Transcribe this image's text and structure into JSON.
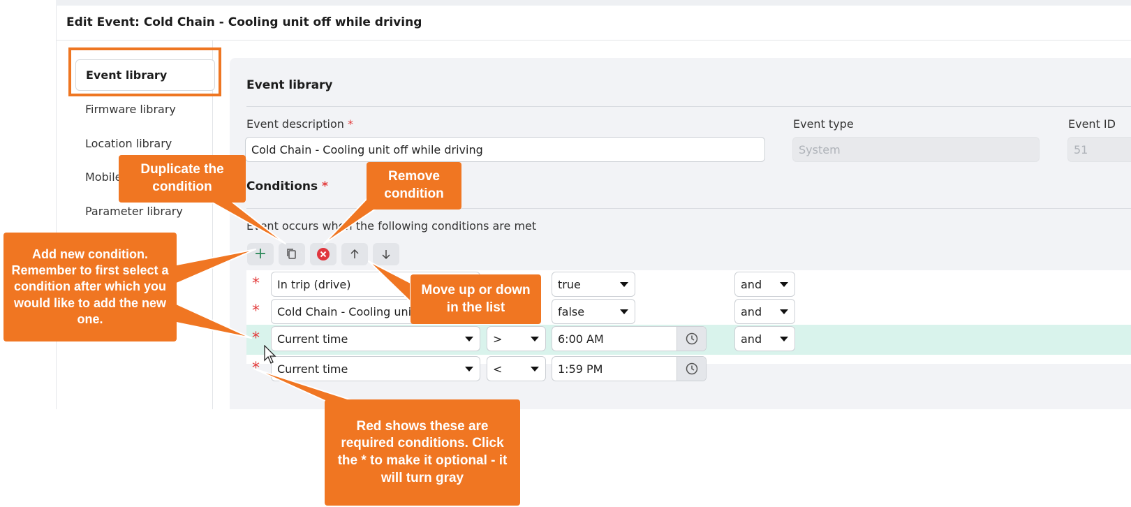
{
  "window_title": "Edit Event: Cold Chain - Cooling unit off while driving",
  "sidebar": {
    "items": [
      {
        "label": "Event library",
        "active": true
      },
      {
        "label": "Firmware library"
      },
      {
        "label": "Location library"
      },
      {
        "label": "Mobile"
      },
      {
        "label": "Parameter library"
      }
    ]
  },
  "section_title": "Event library",
  "fields": {
    "description": {
      "label": "Event description",
      "required": "*",
      "value": "Cold Chain - Cooling unit off while driving"
    },
    "type": {
      "label": "Event type",
      "value": "System"
    },
    "id": {
      "label": "Event ID",
      "value": "51"
    }
  },
  "conditions": {
    "label": "Conditions",
    "required": "*",
    "hint": "Event occurs when the following conditions are met",
    "toolbar": [
      "add",
      "duplicate",
      "remove",
      "move-up",
      "move-down"
    ],
    "rows": [
      {
        "required_mark": "*",
        "param": "In trip (drive)",
        "value": "true",
        "logic": "and"
      },
      {
        "required_mark": "*",
        "param": "Cold Chain - Cooling unit off",
        "value": "false",
        "logic": "and"
      },
      {
        "required_mark": "*",
        "param": "Current time",
        "operator": ">",
        "value": "6:00 AM",
        "logic": "and",
        "selected": true
      },
      {
        "required_mark": "*",
        "param": "Current time",
        "operator": "<",
        "value": "1:59 PM"
      }
    ]
  },
  "callouts": {
    "duplicate": "Duplicate the condition",
    "remove": "Remove condition",
    "add": "Add new condition. Remember to first select a condition after which you would like to add the new one.",
    "move": "Move up or down in the list",
    "required": "Red shows these are required conditions. Click the * to make it optional - it will turn gray"
  },
  "colors": {
    "accent": "#f07622",
    "required": "#e23a3a",
    "selected_row": "#d9f3ec",
    "add_icon": "#2f8a5c"
  }
}
